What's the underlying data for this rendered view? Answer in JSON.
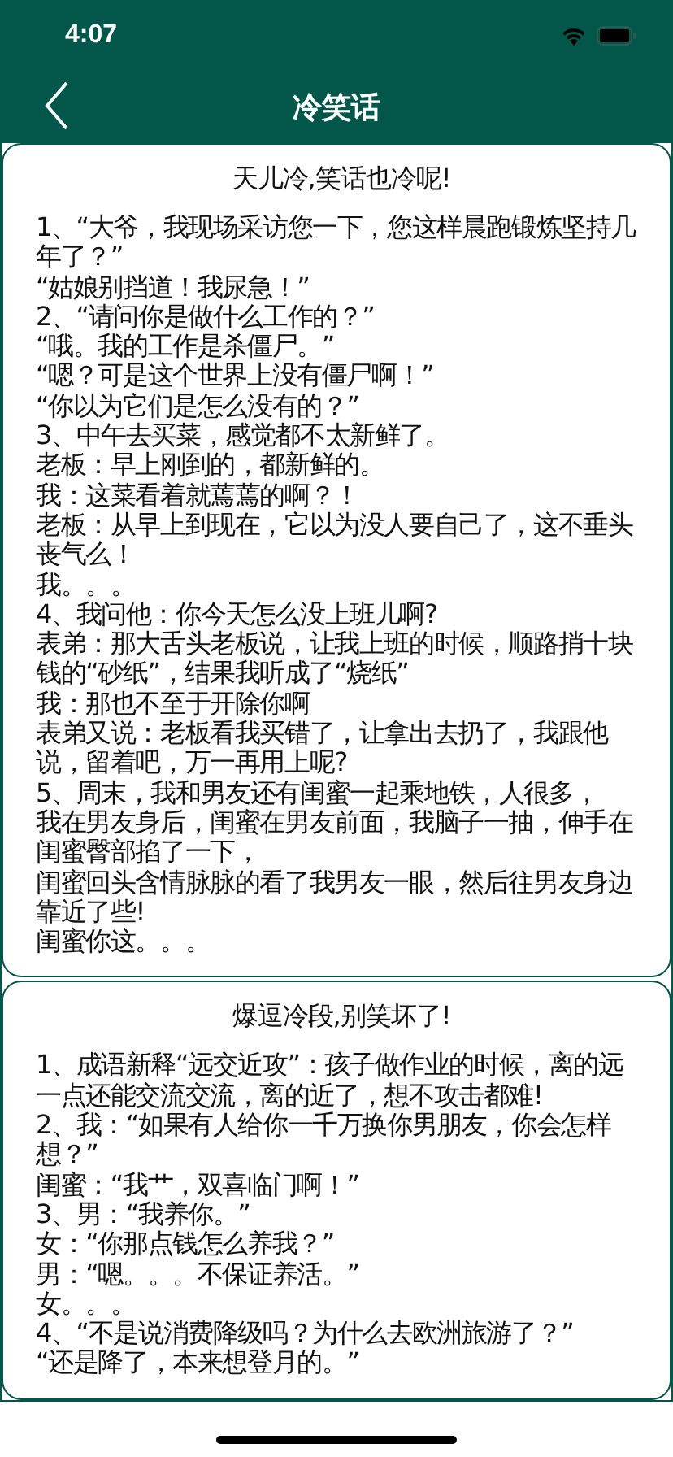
{
  "status_bar": {
    "time": "4:07"
  },
  "nav": {
    "title": "冷笑话"
  },
  "cards": [
    {
      "title": "天儿冷,笑话也冷呢!",
      "lines": [
        "1、“大爷，我现场采访您一下，您这样晨跑锻炼坚持几年了？”",
        "“姑娘别挡道！我尿急！”",
        "2、“请问你是做什么工作的？”",
        "“哦。我的工作是杀僵尸。”",
        "“嗯？可是这个世界上没有僵尸啊！”",
        "“你以为它们是怎么没有的？”",
        "3、中午去买菜，感觉都不太新鲜了。",
        "老板：早上刚到的，都新鲜的。",
        "我：这菜看着就蔫蔫的啊？！",
        "老板：从早上到现在，它以为没人要自己了，这不垂头丧气么！",
        "我。。。",
        "4、我问他：你今天怎么没上班儿啊?",
        "表弟：那大舌头老板说，让我上班的时候，顺路捎十块钱的“砂纸”，结果我听成了“烧纸”",
        "我：那也不至于开除你啊",
        "表弟又说：老板看我买错了，让拿出去扔了，我跟他说，留着吧，万一再用上呢?",
        "5、周末，我和男友还有闺蜜一起乘地铁，人很多，",
        "我在男友身后，闺蜜在男友前面，我脑子一抽，伸手在闺蜜臀部掐了一下，",
        "闺蜜回头含情脉脉的看了我男友一眼，然后往男友身边靠近了些!",
        "闺蜜你这。。。"
      ]
    },
    {
      "title": "爆逗冷段,别笑坏了!",
      "lines": [
        "1、成语新释“远交近攻”：孩子做作业的时候，离的远一点还能交流交流，离的近了，想不攻击都难!",
        "2、我：“如果有人给你一千万换你男朋友，你会怎样想？”",
        "闺蜜：“我艹，双喜临门啊！”",
        "3、男：“我养你。”",
        "女：“你那点钱怎么养我？”",
        "男：“嗯。。。不保证养活。”",
        "女。。。",
        "4、“不是说消费降级吗？为什么去欧洲旅游了？”",
        "“还是降了，本来想登月的。”"
      ]
    }
  ]
}
